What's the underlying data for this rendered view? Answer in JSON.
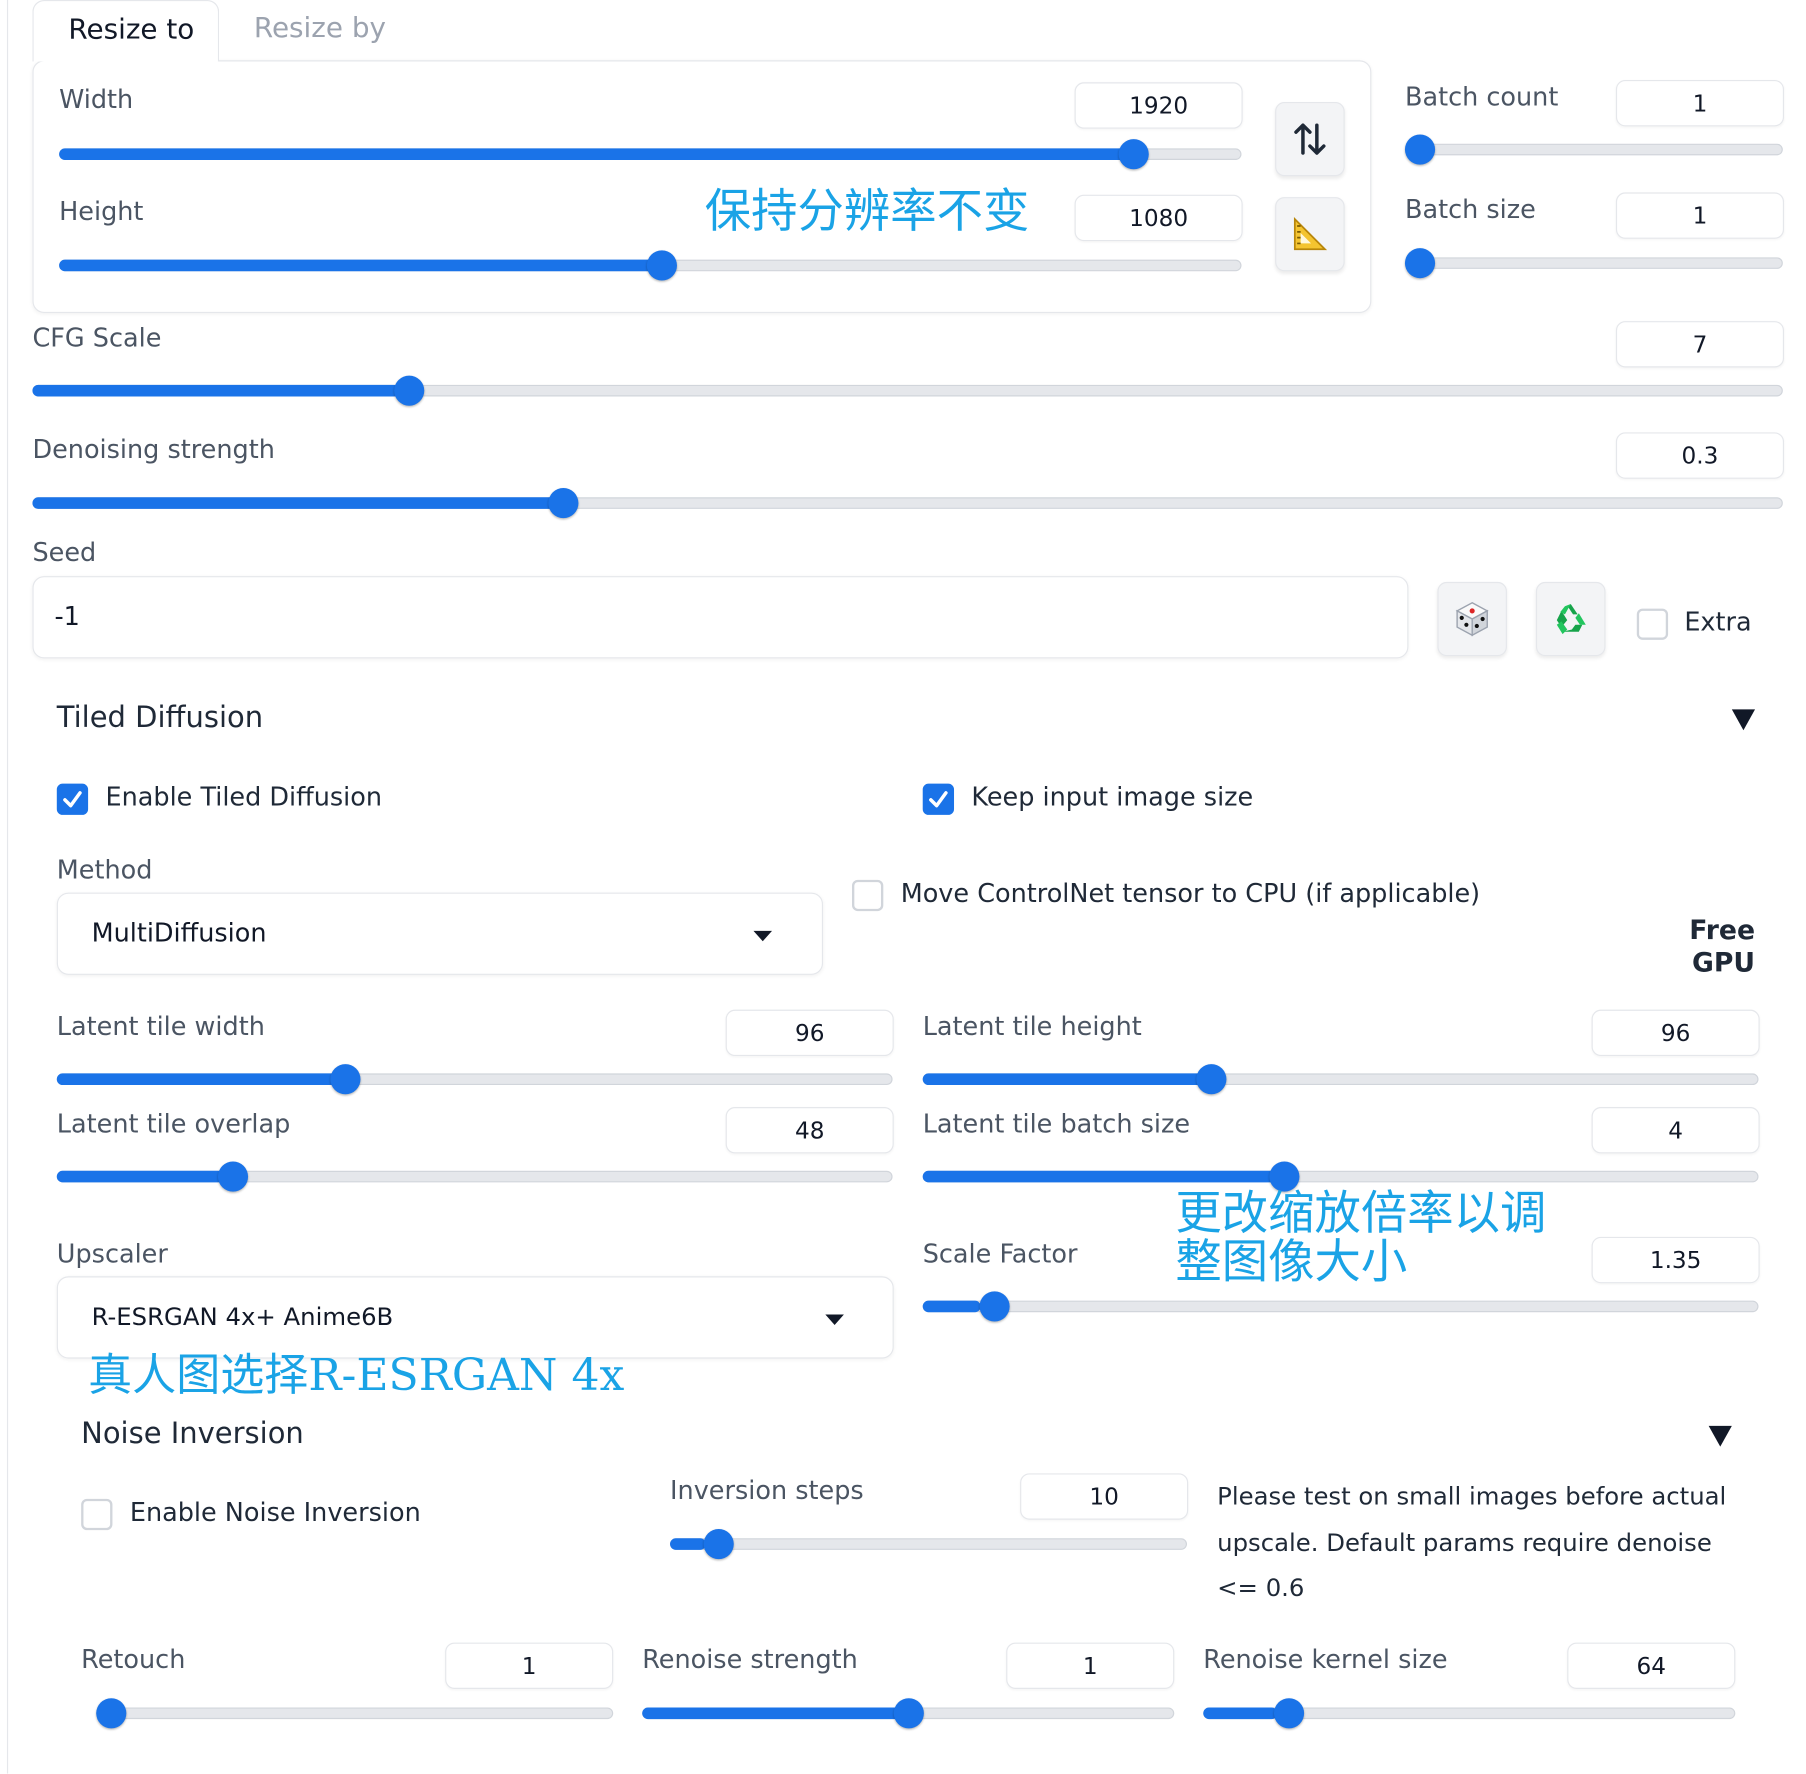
{
  "tabs": {
    "resize_to": "Resize to",
    "resize_by": "Resize by"
  },
  "size": {
    "width_label": "Width",
    "width_value": "1920",
    "width_fraction": 0.92,
    "height_label": "Height",
    "height_value": "1080",
    "height_fraction": 0.51,
    "swap_icon": "swap-vertical-icon",
    "ruler_icon": "ruler-triangle-icon"
  },
  "batch": {
    "count_label": "Batch count",
    "count_value": "1",
    "count_fraction": 0.0,
    "size_label": "Batch size",
    "size_value": "1",
    "size_fraction": 0.0
  },
  "cfg": {
    "label": "CFG Scale",
    "value": "7",
    "fraction": 0.21
  },
  "denoise": {
    "label": "Denoising strength",
    "value": "0.3",
    "fraction": 0.3
  },
  "seed": {
    "label": "Seed",
    "value": "-1",
    "dice_icon": "dice-icon",
    "recycle_icon": "recycle-icon",
    "extra_label": "Extra"
  },
  "tiled": {
    "title": "Tiled Diffusion",
    "enable_label": "Enable Tiled Diffusion",
    "enable_checked": true,
    "keep_label": "Keep input image size",
    "keep_checked": true,
    "method_label": "Method",
    "method_value": "MultiDiffusion",
    "move_cn_label": "Move ControlNet tensor to CPU (if applicable)",
    "move_cn_checked": false,
    "free_gpu_line1": "Free",
    "free_gpu_line2": "GPU",
    "tile_width_label": "Latent tile width",
    "tile_width_value": "96",
    "tile_width_fraction": 0.34,
    "tile_height_label": "Latent tile height",
    "tile_height_value": "96",
    "tile_height_fraction": 0.34,
    "overlap_label": "Latent tile overlap",
    "overlap_value": "48",
    "overlap_fraction": 0.2,
    "batch_label": "Latent tile batch size",
    "batch_value": "4",
    "batch_fraction": 0.43,
    "upscaler_label": "Upscaler",
    "upscaler_value": "R-ESRGAN 4x+ Anime6B",
    "scale_label": "Scale Factor",
    "scale_value": "1.35",
    "scale_fraction": 0.07
  },
  "noise": {
    "title": "Noise Inversion",
    "enable_label": "Enable Noise Inversion",
    "enable_checked": false,
    "steps_label": "Inversion steps",
    "steps_value": "10",
    "steps_fraction": 0.07,
    "note": "Please test on small images before actual upscale. Default params require denoise <= 0.6",
    "retouch_label": "Retouch",
    "retouch_value": "1",
    "retouch_fraction": 0.0,
    "renoise_label": "Renoise strength",
    "renoise_value": "1",
    "renoise_fraction": 0.5,
    "kernel_label": "Renoise kernel size",
    "kernel_value": "64",
    "kernel_fraction": 0.14
  },
  "annotations": {
    "keep_resolution": "保持分辨率不变",
    "scale_line1": "更改缩放倍率以调",
    "scale_line2": "整图像大小",
    "upscaler_tip": "真人图选择R-ESRGAN 4x"
  },
  "colors": {
    "accent": "#1a73e8",
    "annotation": "#1aa3e6"
  }
}
